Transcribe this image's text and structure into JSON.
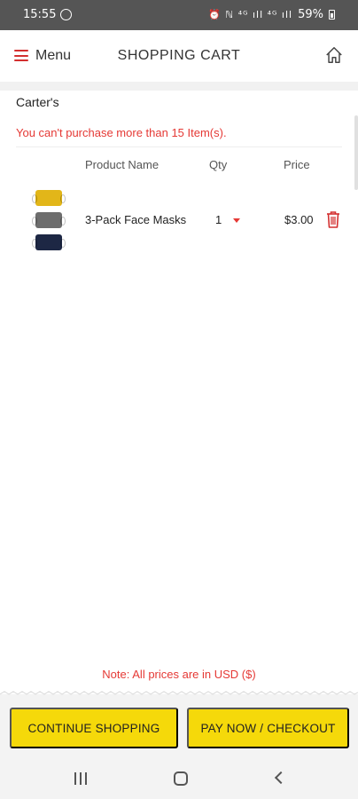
{
  "status_bar": {
    "time": "15:55",
    "icons_text": "⏰ ℕ ⁴ᴳ ıll ⁴ᴳ ıll",
    "battery": "59%"
  },
  "header": {
    "menu_label": "Menu",
    "title": "SHOPPING CART"
  },
  "cart": {
    "store_name": "Carter's",
    "limit_warning": "You can't purchase more than 15 Item(s).",
    "columns": {
      "product": "Product Name",
      "qty": "Qty",
      "price": "Price"
    },
    "items": [
      {
        "name": "3-Pack Face Masks",
        "qty": "1",
        "price": "$3.00"
      }
    ],
    "note": "Note: All prices are in USD ($)"
  },
  "actions": {
    "continue_label": "CONTINUE SHOPPING",
    "checkout_label": "PAY NOW / CHECKOUT"
  },
  "colors": {
    "accent_red": "#e53935",
    "button_yellow": "#f5d90a",
    "status_bar": "#555555"
  },
  "icons": [
    "whatsapp-icon",
    "menu-icon",
    "home-icon",
    "caret-down-icon",
    "trash-icon",
    "nav-recents-icon",
    "nav-home-icon",
    "nav-back-icon"
  ]
}
